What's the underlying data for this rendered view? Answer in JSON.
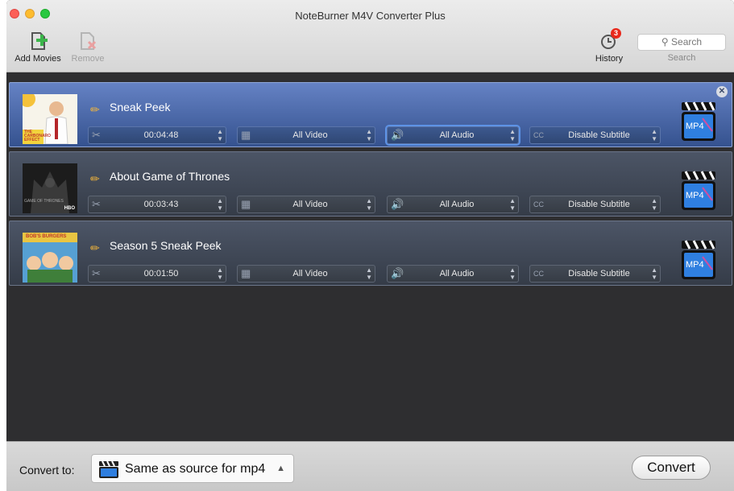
{
  "window": {
    "title": "NoteBurner M4V Converter Plus"
  },
  "toolbar": {
    "add_movies": "Add Movies",
    "remove": "Remove",
    "history": "History",
    "history_badge": "3",
    "search_placeholder": "Search",
    "search_label": "Search"
  },
  "items": [
    {
      "title": "Sneak Peek",
      "duration": "00:04:48",
      "video": "All Video",
      "audio": "All Audio",
      "subtitle": "Disable Subtitle",
      "format_badge": "MP4",
      "poster_text": "THE CARBONARO EFFECT",
      "selected": true
    },
    {
      "title": "About Game of Thrones",
      "duration": "00:03:43",
      "video": "All Video",
      "audio": "All Audio",
      "subtitle": "Disable Subtitle",
      "format_badge": "MP4",
      "poster_text": "GAME OF THRONES",
      "poster_brand": "HBO"
    },
    {
      "title": "Season 5 Sneak Peek",
      "duration": "00:01:50",
      "video": "All Video",
      "audio": "All Audio",
      "subtitle": "Disable Subtitle",
      "format_badge": "MP4",
      "poster_text": "BOB'S BURGERS"
    }
  ],
  "bottom": {
    "convert_to_label": "Convert to:",
    "format_value": "Same as source for mp4",
    "convert_button": "Convert"
  },
  "icons": {
    "add": "add-movie-icon",
    "remove": "remove-movie-icon",
    "history": "history-clock-icon",
    "search": "search-icon",
    "edit": "pencil-icon",
    "trim": "scissors-icon",
    "video": "film-icon",
    "audio": "speaker-icon",
    "subtitle": "cc-icon",
    "output": "mp4-clapper-icon",
    "close": "close-icon"
  },
  "colors": {
    "selected_row": "#4f6cae",
    "row": "#414957",
    "badge": "#e8291c",
    "pencil": "#f4b63b"
  }
}
